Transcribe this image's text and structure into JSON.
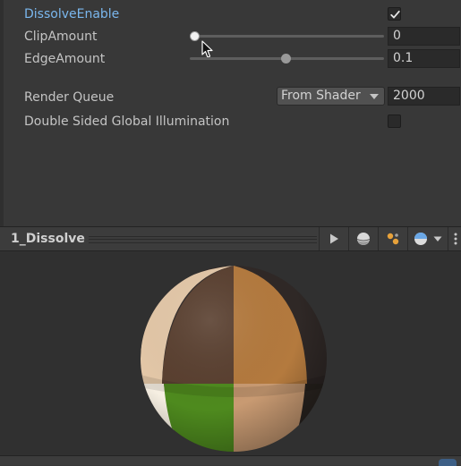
{
  "inspector": {
    "dissolve_enable": {
      "label": "DissolveEnable",
      "checked": true
    },
    "clip_amount": {
      "label": "ClipAmount",
      "value": "0",
      "slider_fraction": 0.0
    },
    "edge_amount": {
      "label": "EdgeAmount",
      "value": "0.1",
      "slider_fraction": 0.5
    },
    "render_queue": {
      "label": "Render Queue",
      "mode": "From Shader",
      "value": "2000"
    },
    "double_sided_gi": {
      "label": "Double Sided Global Illumination",
      "checked": false
    }
  },
  "preview": {
    "title": "1_Dissolve",
    "buttons": [
      "play-icon",
      "sphere-mesh-icon",
      "light-icon",
      "background-sphere-icon",
      "chevron-down-icon",
      "more-icon"
    ]
  },
  "colors": {
    "accent_label": "#7ab7ee",
    "background": "#383838",
    "sphere_quadrants": [
      "#e4c8a8",
      "#5a4030",
      "#b47a3e",
      "#2f2826",
      "#f6efe2",
      "#4e8a1e",
      "#c89a72",
      "#2a2420"
    ]
  }
}
